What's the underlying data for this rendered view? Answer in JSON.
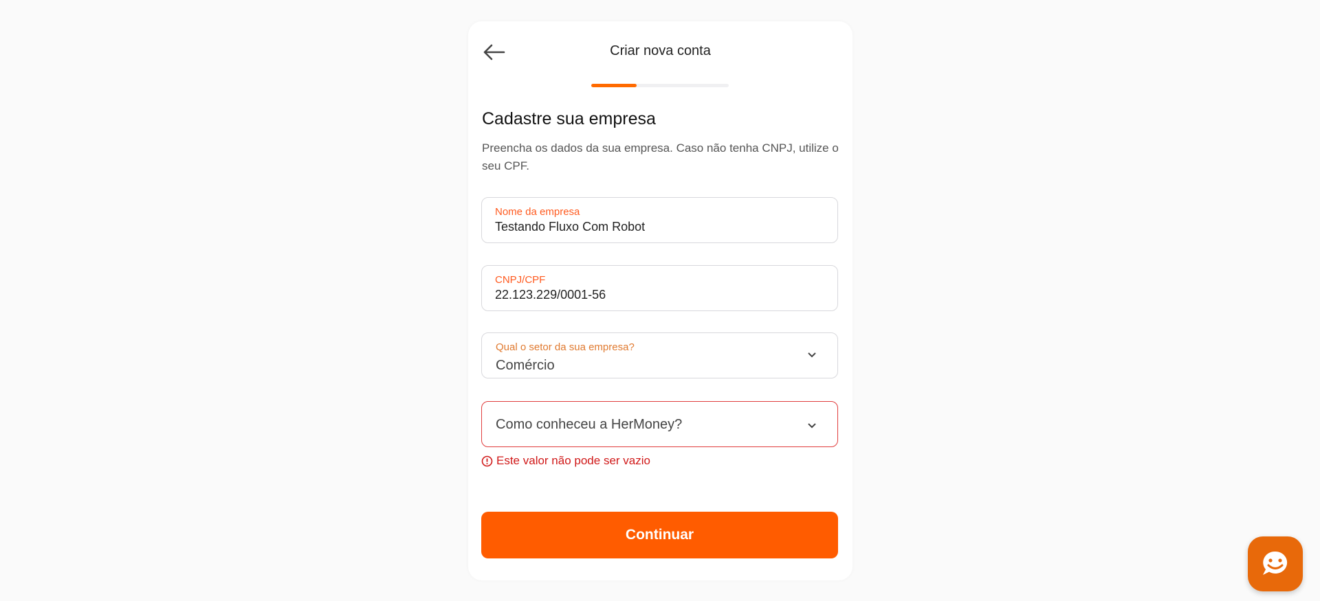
{
  "header": {
    "title": "Criar nova conta",
    "back_icon": "arrow-left-icon"
  },
  "progress": {
    "value": 0.33,
    "color": "#ff6a00"
  },
  "main": {
    "heading": "Cadastre sua empresa",
    "description": "Preencha os dados da sua empresa. Caso não tenha CNPJ, utilize o seu CPF.",
    "fields": [
      {
        "label": "Nome da empresa",
        "value": "Testando Fluxo Com Robot"
      },
      {
        "label": "CNPJ/CPF",
        "value": "22.123.229/0001-56"
      }
    ],
    "selects": [
      {
        "label": "Qual o setor da sua empresa?",
        "value": "Comércio"
      },
      {
        "placeholder": "Como conheceu a HerMoney?",
        "error": "Este valor não pode ser vazio"
      }
    ],
    "continue_label": "Continuar"
  },
  "colors": {
    "accent": "#ff5c00",
    "error": "#d01818",
    "chat": "#e8690a"
  },
  "chat": {
    "icon": "chat-smile-icon"
  }
}
